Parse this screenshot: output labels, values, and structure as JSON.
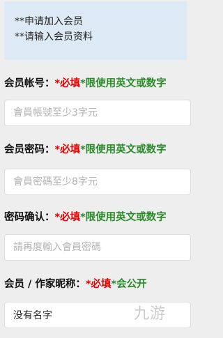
{
  "notice": {
    "line1": "**申请加入会员",
    "line2": "**请输入会员资料"
  },
  "fields": [
    {
      "label": "会员帐号：",
      "required": "*必填",
      "note": "*限使用英文或数字",
      "placeholder": "會員帳號至少3字元",
      "value": ""
    },
    {
      "label": "会员密码：",
      "required": "*必填",
      "note": "*限使用英文或数字",
      "placeholder": "會員密碼至少8字元",
      "value": ""
    },
    {
      "label": "密码确认：",
      "required": "*必填",
      "note": "*限使用英文或数字",
      "placeholder": "請再度輸入會員密碼",
      "value": ""
    },
    {
      "label": "会员 / 作家昵称：",
      "required": "*必填",
      "note": "*会公开",
      "placeholder": "",
      "value": "没有名字"
    }
  ],
  "watermark": "九游"
}
